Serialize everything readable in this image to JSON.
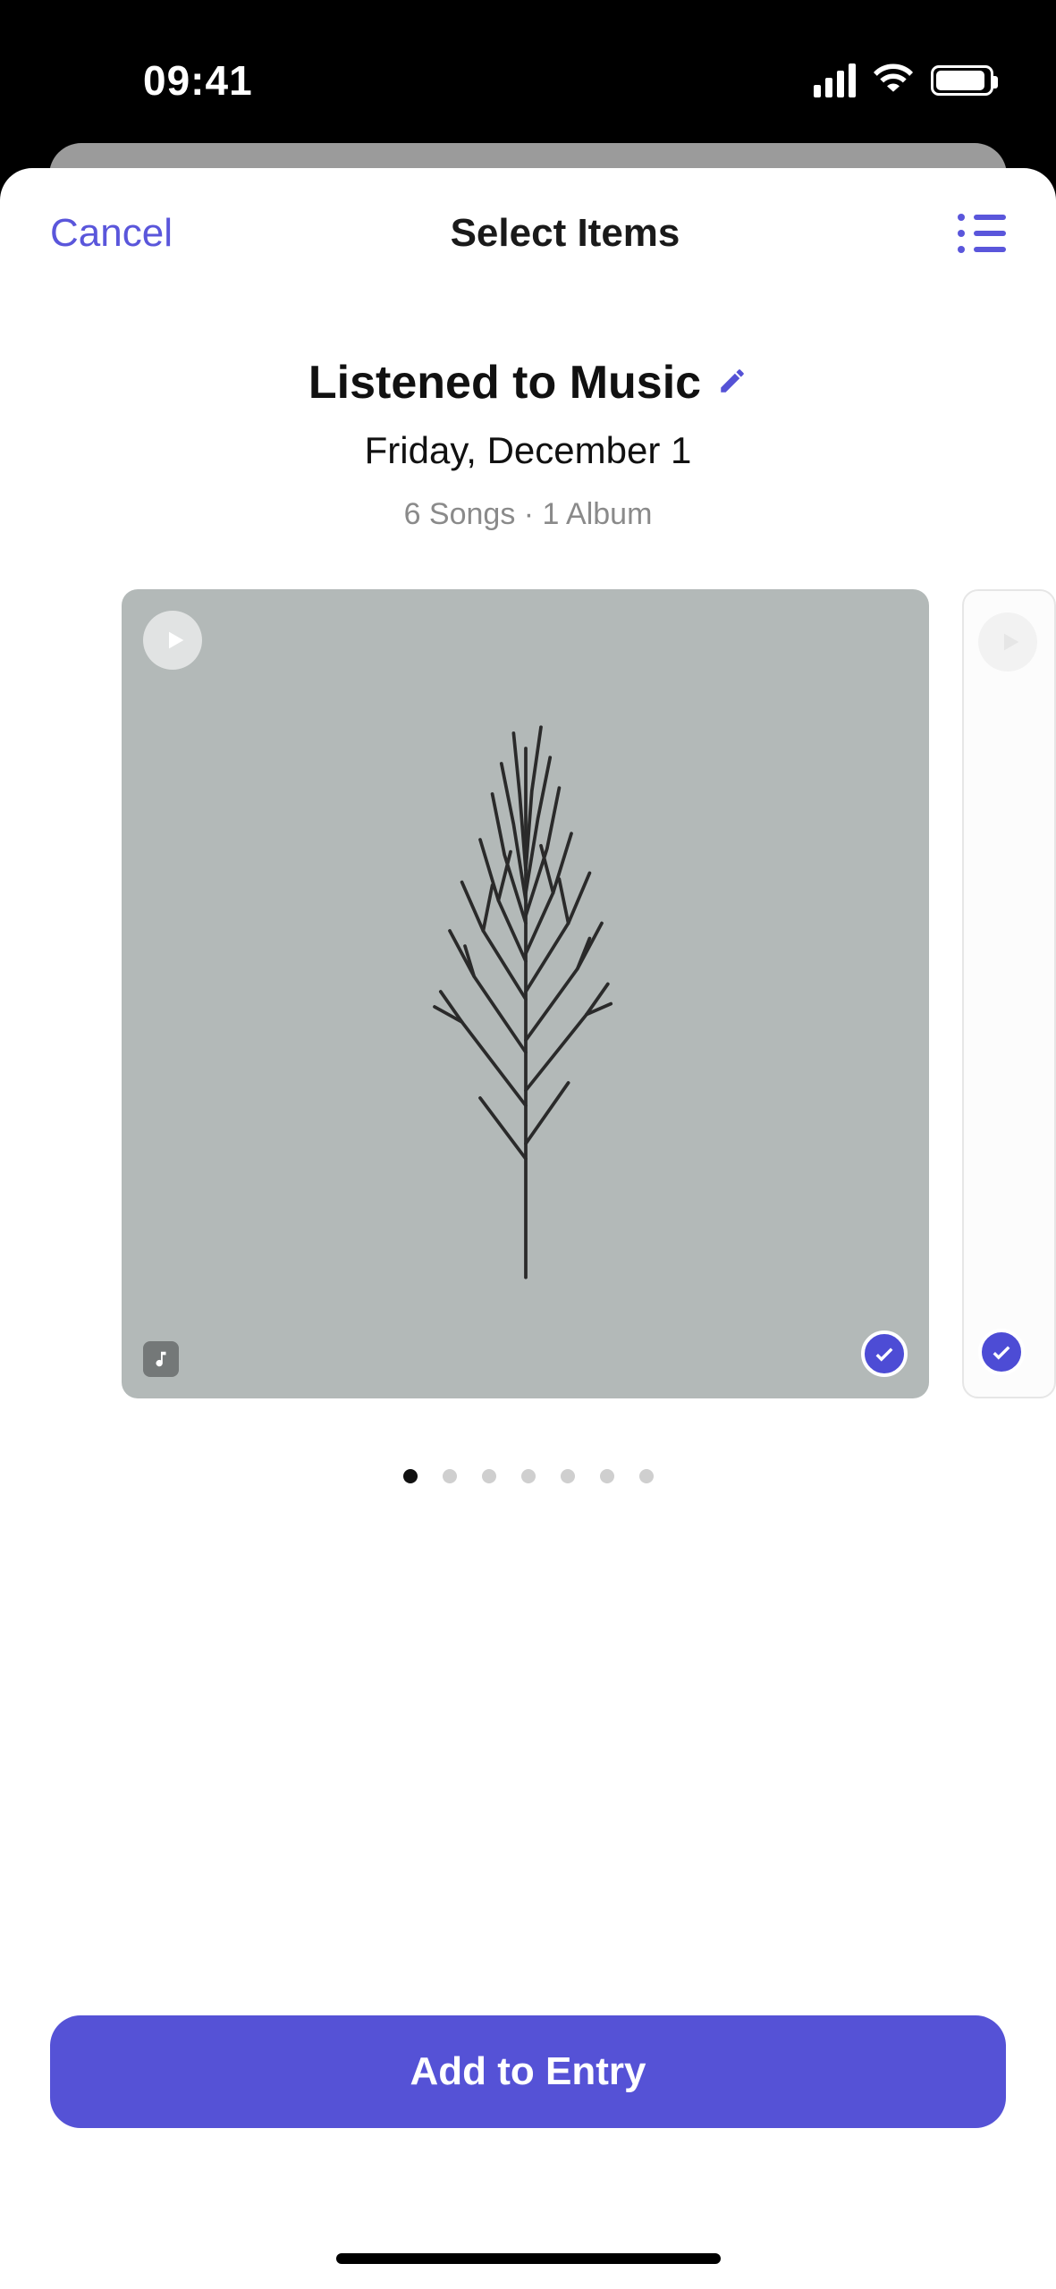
{
  "status": {
    "time": "09:41"
  },
  "nav": {
    "cancel": "Cancel",
    "title": "Select Items"
  },
  "section": {
    "title": "Listened to Music",
    "date": "Friday, December 1",
    "meta": "6 Songs  ·  1 Album"
  },
  "carousel": {
    "total_pages": 7,
    "active_page": 0
  },
  "action": {
    "label": "Add to Entry"
  },
  "colors": {
    "accent": "#5552d6"
  }
}
